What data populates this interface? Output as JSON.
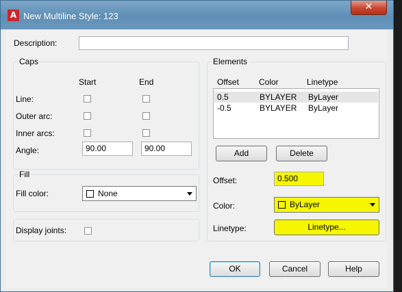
{
  "window": {
    "title": "New Multiline Style: 123",
    "app_icon_letter": "A",
    "close_glyph": "✕",
    "description_label": "Description:",
    "description_value": ""
  },
  "caps": {
    "group_label": "Caps",
    "start_header": "Start",
    "end_header": "End",
    "line_label": "Line:",
    "outer_arc_label": "Outer arc:",
    "inner_arcs_label": "Inner arcs:",
    "angle_label": "Angle:",
    "angle_start": "90.00",
    "angle_end": "90.00"
  },
  "fill": {
    "group_label": "Fill",
    "fill_color_label": "Fill color:",
    "fill_color_value": "None"
  },
  "display_joints": {
    "label": "Display joints:"
  },
  "elements": {
    "group_label": "Elements",
    "headers": {
      "offset": "Offset",
      "color": "Color",
      "linetype": "Linetype"
    },
    "rows": [
      {
        "offset": "0.5",
        "color": "BYLAYER",
        "linetype": "ByLayer"
      },
      {
        "offset": "-0.5",
        "color": "BYLAYER",
        "linetype": "ByLayer"
      }
    ],
    "add_label": "Add",
    "delete_label": "Delete",
    "offset_label": "Offset:",
    "offset_value": "0.500",
    "color_label": "Color:",
    "color_value": "ByLayer",
    "linetype_label": "Linetype:",
    "linetype_button": "Linetype..."
  },
  "footer": {
    "ok_label": "OK",
    "cancel_label": "Cancel",
    "help_label": "Help"
  },
  "colors": {
    "highlight": "#f6f600",
    "title_bar": "#6a97bd",
    "close_button": "#c9452f"
  }
}
